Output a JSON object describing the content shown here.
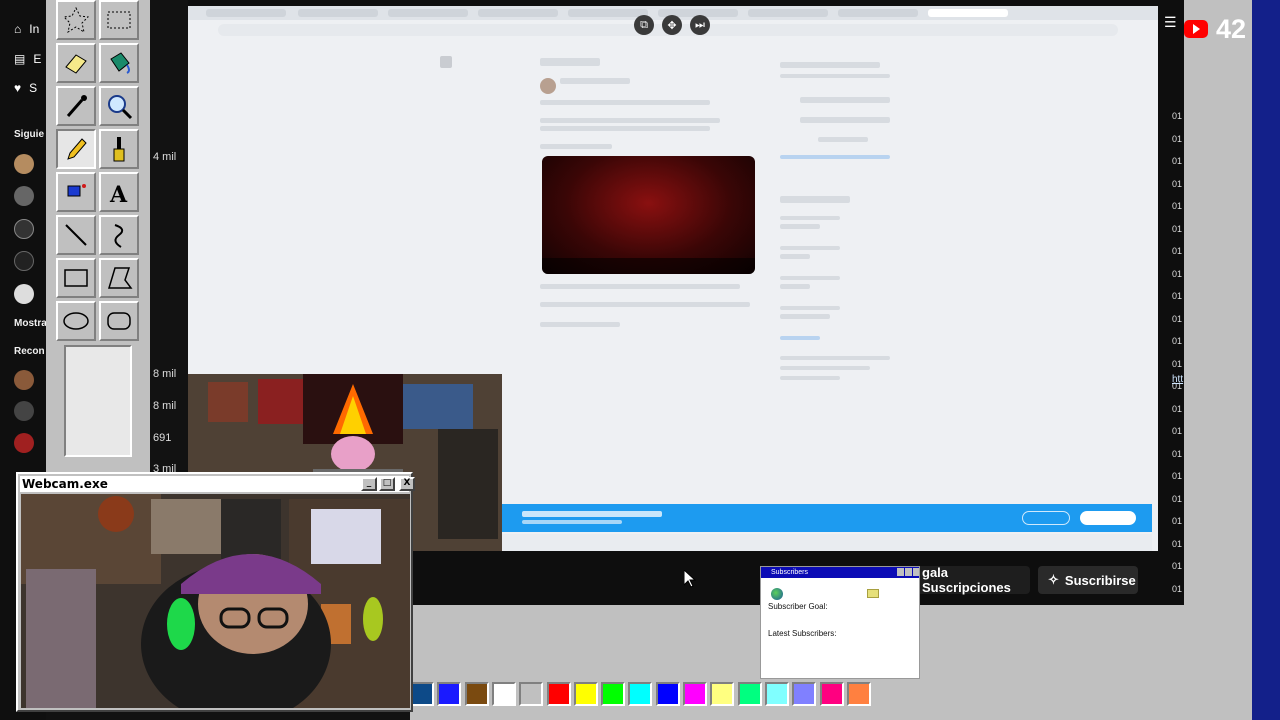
{
  "sidebar": {
    "home_label": "In",
    "subs_label": "E",
    "likes_label": "S",
    "following_heading": "Siguie",
    "shown_heading": "Mostra",
    "recommended_heading": "Recon"
  },
  "middle_column": {
    "stats": [
      "4 mil",
      "8 mil",
      "8 mil",
      "691",
      "3 mil"
    ]
  },
  "paint": {
    "tools": [
      "free-select-icon",
      "rect-select-icon",
      "eraser-icon",
      "fill-bucket-icon",
      "color-picker-icon",
      "magnifier-icon",
      "pencil-icon",
      "brush-icon",
      "airbrush-icon",
      "text-tool-icon",
      "line-tool-icon",
      "curve-tool-icon",
      "rectangle-tool-icon",
      "polygon-tool-icon",
      "ellipse-tool-icon",
      "rounded-rect-tool-icon"
    ],
    "active_tool": "pencil-icon",
    "palette": [
      "#0d4a88",
      "#1a1aff",
      "#7a4a10",
      "#ffffff",
      "#c0c0c0",
      "#ff0000",
      "#ffff00",
      "#00ff00",
      "#00ffff",
      "#0000ff",
      "#ff00ff",
      "#ffff80",
      "#00ff80",
      "#80ffff",
      "#8080ff",
      "#ff0080",
      "#ff8040"
    ]
  },
  "webcam_window": {
    "title": "Webcam.exe",
    "min_label": "_",
    "max_label": "□",
    "close_label": "X"
  },
  "youtube": {
    "live_count": "42",
    "time_labels": [
      "01",
      "01",
      "01",
      "01",
      "01",
      "01",
      "01",
      "01",
      "01",
      "01",
      "01",
      "01",
      "01",
      "01",
      "01",
      "01",
      "01",
      "01",
      "01",
      "01",
      "01",
      "01"
    ],
    "link_fragment": "htt",
    "gift_label": "gala Suscripciones",
    "subscribe_label": "Suscribirse"
  },
  "subscribers_widget": {
    "title": "Subscribers",
    "goal_label": "Subscriber Goal:",
    "latest_label": "Latest Subscribers:"
  }
}
